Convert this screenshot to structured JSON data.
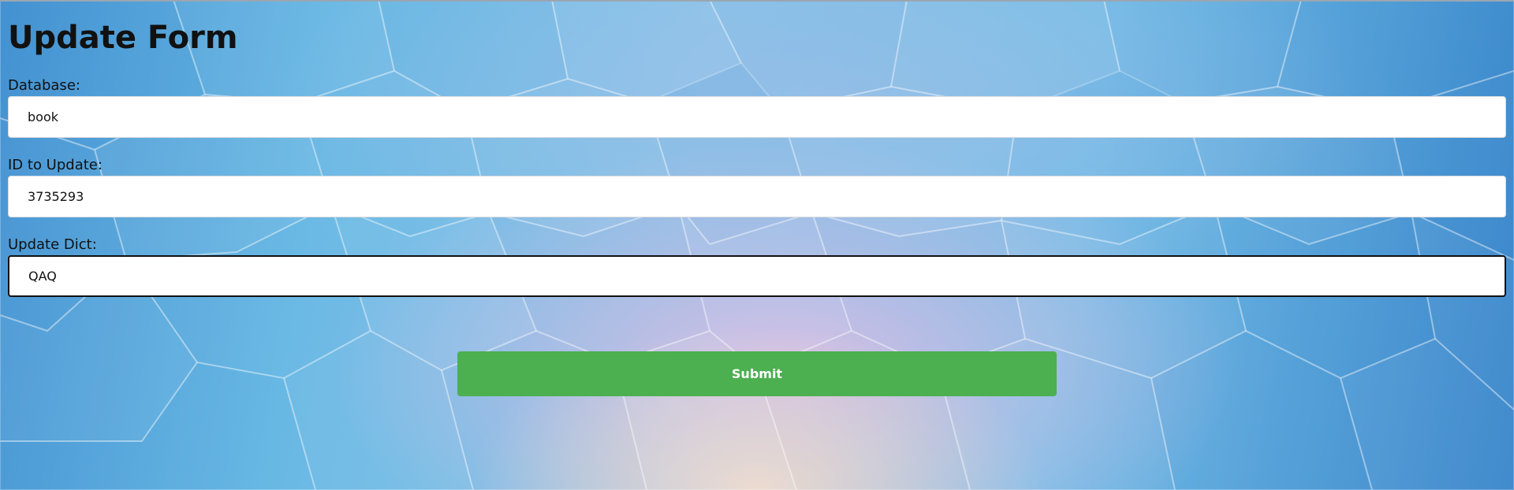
{
  "form": {
    "title": "Update Form",
    "fields": [
      {
        "label": "Database:",
        "value": "book"
      },
      {
        "label": "ID to Update:",
        "value": "3735293"
      },
      {
        "label": "Update Dict:",
        "value": "QAQ"
      }
    ],
    "submit_label": "Submit"
  },
  "colors": {
    "submit_button": "#4caf50",
    "background_primary": "#5fb4e3",
    "background_accent": "#d6b8e2"
  }
}
